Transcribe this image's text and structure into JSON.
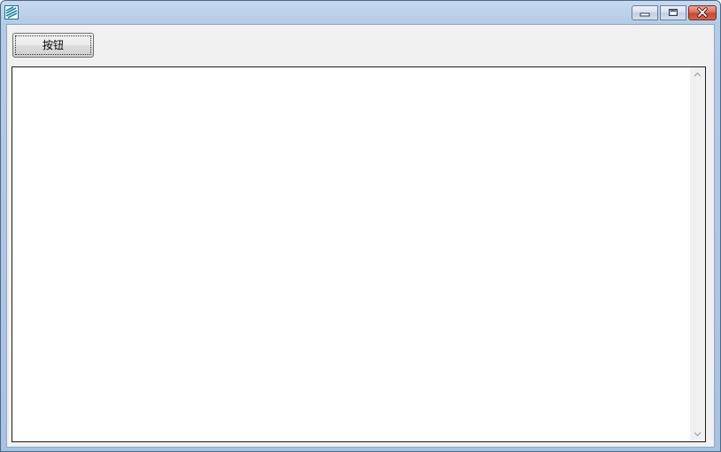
{
  "window": {
    "icon": "app-logo-icon",
    "controls": [
      "minimize-icon",
      "maximize-icon",
      "close-icon"
    ]
  },
  "toolbar": {
    "button_label": "按钮"
  },
  "editor": {
    "content": ""
  }
}
